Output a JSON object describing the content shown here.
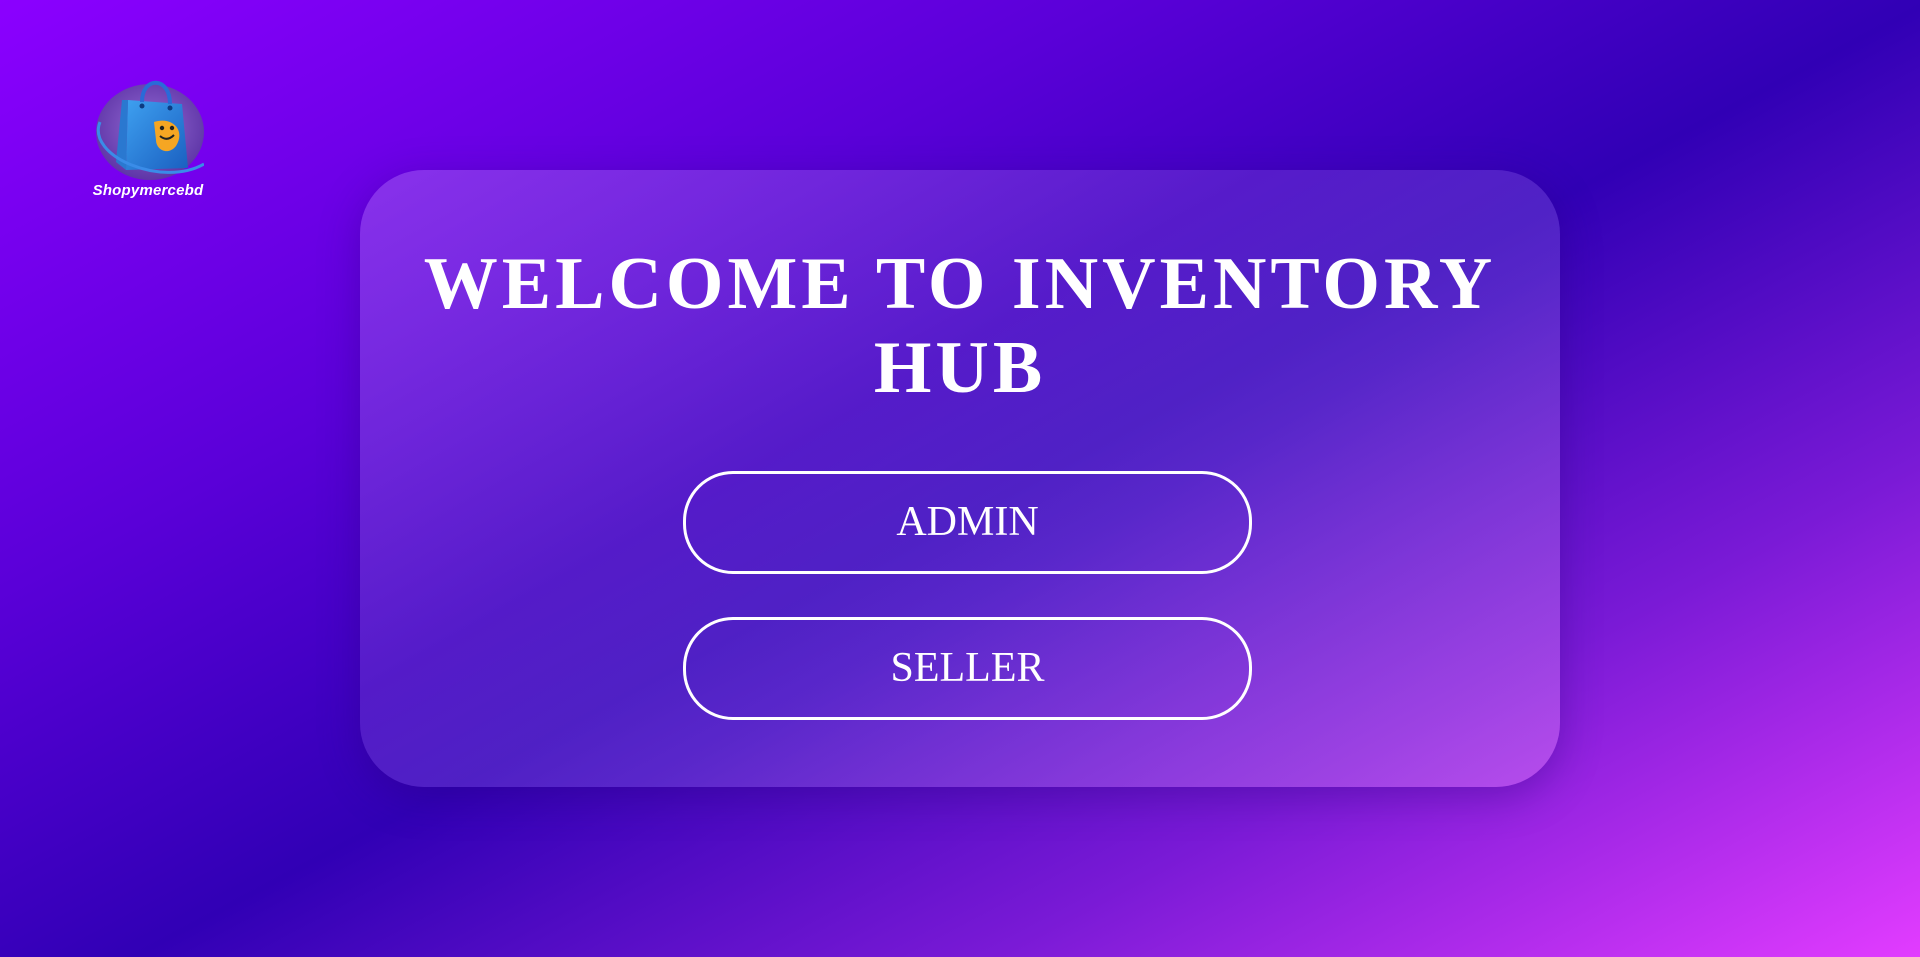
{
  "brand": {
    "logo_icon": "shopping-bag-logo",
    "name": "Shopymercebd"
  },
  "welcome": {
    "title": "WELCOME TO INVENTORY HUB"
  },
  "actions": {
    "admin_label": "ADMIN",
    "seller_label": "SELLER"
  },
  "colors": {
    "gradient_start": "#8b00ff",
    "gradient_mid": "#3100b5",
    "gradient_end": "#e23cff",
    "text": "#ffffff",
    "button_border": "#ffffff"
  }
}
